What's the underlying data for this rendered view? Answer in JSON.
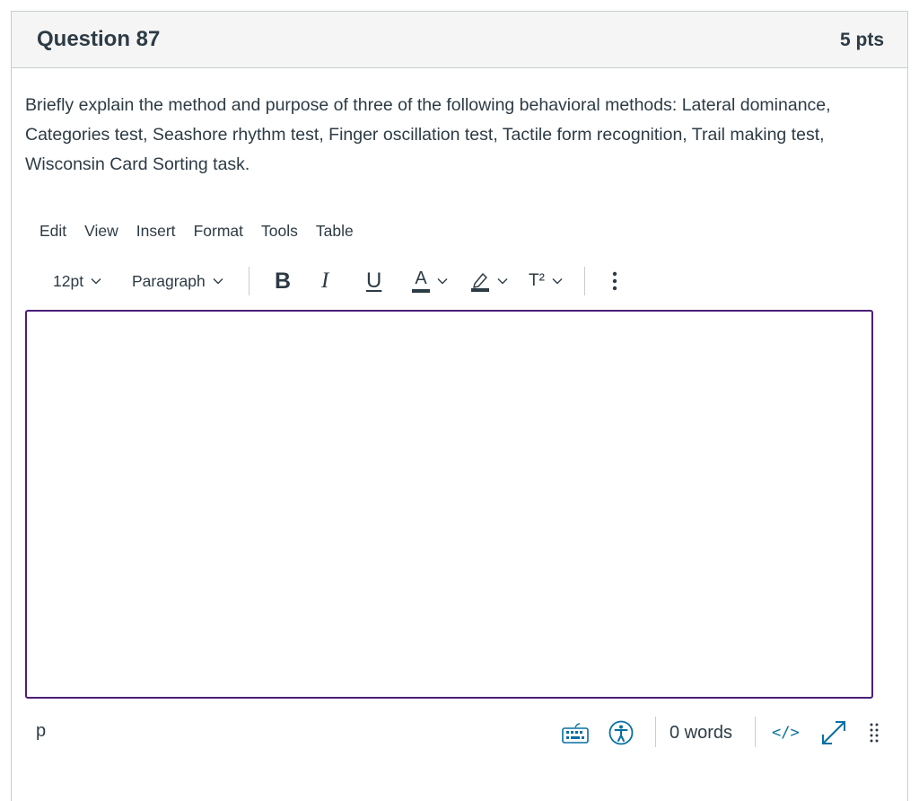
{
  "question": {
    "title": "Question 87",
    "points": "5 pts",
    "text": "Briefly explain the method and purpose of three of the following behavioral methods: Lateral dominance, Categories test, Seashore rhythm test, Finger oscillation test, Tactile form recognition, Trail making test, Wisconsin Card Sorting task."
  },
  "editor": {
    "menubar": [
      "Edit",
      "View",
      "Insert",
      "Format",
      "Tools",
      "Table"
    ],
    "toolbar": {
      "font_size": "12pt",
      "block_format": "Paragraph",
      "bold_glyph": "B",
      "italic_glyph": "I",
      "underline_glyph": "U",
      "text_color_glyph": "A",
      "superscript_glyph": "T²",
      "icons": [
        "chevron-down-icon",
        "highlight-pen-icon",
        "more-vertical-icon"
      ]
    },
    "accent_color": "#4b1e78",
    "content": ""
  },
  "statusbar": {
    "element_path": "p",
    "word_count": "0 words",
    "html_toggle": "</>",
    "icons": [
      "keyboard-icon",
      "accessibility-icon",
      "expand-icon",
      "drag-handle-icon"
    ]
  },
  "colors": {
    "text": "#2d3b45",
    "border": "#c7cdd1",
    "header_bg": "#f5f5f5",
    "link_blue": "#0770a3"
  }
}
